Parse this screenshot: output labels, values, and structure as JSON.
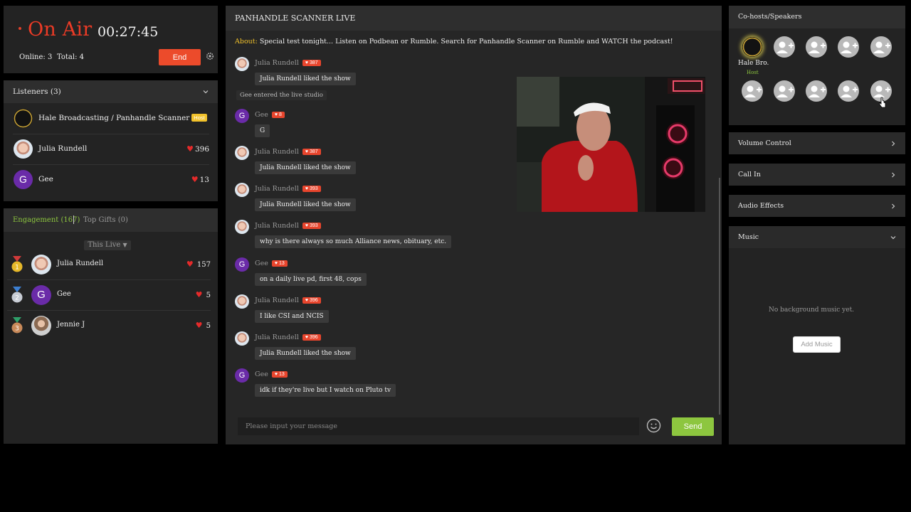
{
  "onair": {
    "title": "On Air",
    "timer": "00:27:45",
    "online": "Online: 3",
    "total": "Total: 4",
    "end_label": "End"
  },
  "listeners": {
    "header": "Listeners (3)",
    "items": [
      {
        "name": "Hale Broadcasting / Panhandle Scanner",
        "badge": "Host",
        "count": ""
      },
      {
        "name": "Julia Rundell",
        "count": "396"
      },
      {
        "name": "Gee",
        "initial": "G",
        "count": "13"
      }
    ]
  },
  "engagement": {
    "tab_engagement": "Engagement (167)",
    "tab_gifts": "Top Gifts (0)",
    "filter": "This Live",
    "rows": [
      {
        "rank": "1",
        "name": "Julia Rundell",
        "count": "157"
      },
      {
        "rank": "2",
        "name": "Gee",
        "initial": "G",
        "count": "5"
      },
      {
        "rank": "3",
        "name": "Jennie J",
        "count": "5"
      }
    ]
  },
  "chat": {
    "title": "PANHANDLE SCANNER LIVE",
    "about_label": "About:",
    "about_text": "Special test tonight... Listen on Podbean or Rumble. Search for Panhandle Scanner on Rumble and WATCH the podcast!",
    "system_message": "Gee entered the live studio",
    "messages": [
      {
        "name": "Julia Rundell",
        "level": "387",
        "text": "Julia Rundell liked the show"
      },
      {
        "name": "Gee",
        "initial": "G",
        "level": "8",
        "text": "G"
      },
      {
        "name": "Julia Rundell",
        "level": "387",
        "text": "Julia Rundell liked the show"
      },
      {
        "name": "Julia Rundell",
        "level": "393",
        "text": "Julia Rundell liked the show"
      },
      {
        "name": "Julia Rundell",
        "level": "393",
        "text": "why is there always so much Alliance news, obituary, etc."
      },
      {
        "name": "Gee",
        "initial": "G",
        "level": "13",
        "text": "on a daily live pd, first 48, cops"
      },
      {
        "name": "Julia Rundell",
        "level": "396",
        "text": "I like CSI and NCIS"
      },
      {
        "name": "Julia Rundell",
        "level": "396",
        "text": "Julia Rundell liked the show"
      },
      {
        "name": "Gee",
        "initial": "G",
        "level": "13",
        "text": "idk if they're live but I watch on Pluto tv"
      }
    ],
    "input_placeholder": "Please input your message",
    "send_label": "Send"
  },
  "cohosts": {
    "header": "Co-hosts/Speakers",
    "host_name": "Hale Bro...",
    "host_tag": "Host"
  },
  "sections": {
    "volume": "Volume Control",
    "callin": "Call In",
    "effects": "Audio Effects",
    "music": "Music"
  },
  "music": {
    "empty": "No background music yet.",
    "add_label": "Add Music"
  },
  "colors": {
    "accent_red": "#ec4b2b",
    "accent_green": "#8dc63f",
    "host_yellow": "#f2c22b"
  }
}
